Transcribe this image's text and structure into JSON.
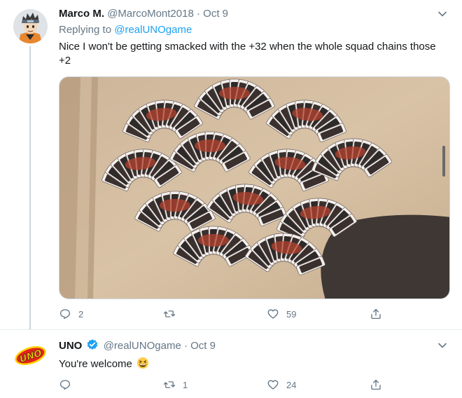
{
  "tweets": [
    {
      "display_name": "Marco M.",
      "handle": "@MarcoMont2018",
      "separator": "·",
      "date": "Oct 9",
      "reply_prefix": "Replying to",
      "reply_to": "@realUNOgame",
      "text": "Nice I won't be getting smacked with the +32 when the whole squad chains those +2",
      "reply_count": "2",
      "retweet_count": "",
      "like_count": "59"
    },
    {
      "display_name": "UNO",
      "verified": true,
      "handle": "@realUNOgame",
      "separator": "·",
      "date": "Oct 9",
      "avatar_logo_text": "UNO",
      "text": "You're welcome",
      "emoji": "grinning-squinting-face",
      "reply_count": "",
      "retweet_count": "1",
      "like_count": "24"
    }
  ],
  "colors": {
    "link": "#1da1f2",
    "secondary_text": "#657786",
    "primary_text": "#14171a",
    "divider": "#e6ecf0",
    "uno_red": "#e2231a",
    "uno_yellow": "#ffd200"
  },
  "icons": [
    "reply-icon",
    "retweet-icon",
    "like-icon",
    "share-icon",
    "chevron-down-icon",
    "verified-badge-icon"
  ]
}
